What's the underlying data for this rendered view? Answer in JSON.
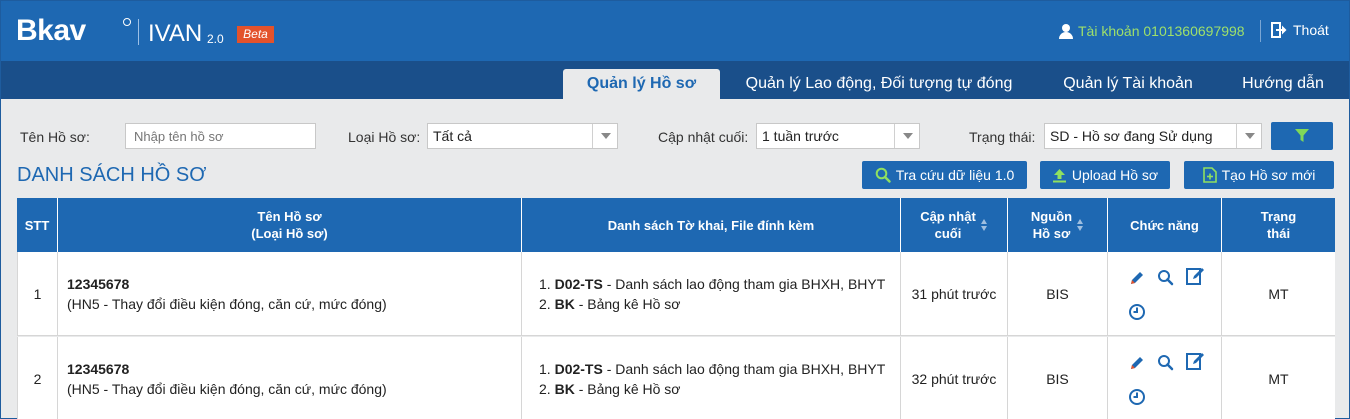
{
  "header": {
    "logo": "Bkav",
    "product": "IVAN",
    "product_version": "2.0",
    "beta": "Beta",
    "account_text": "Tài khoản 0101360697998",
    "logout": "Thoát",
    "colors": {
      "primary": "#1e68b2",
      "nav": "#1a4f8a",
      "account": "#9ee06a",
      "beta": "#e3522b"
    }
  },
  "nav": {
    "tabs": [
      {
        "label": "Quản lý Hồ sơ",
        "active": true
      },
      {
        "label": "Quản lý Lao động, Đối tượng tự đóng",
        "active": false
      },
      {
        "label": "Quản lý Tài khoản",
        "active": false
      },
      {
        "label": "Hướng dẫn",
        "active": false
      }
    ]
  },
  "filters": {
    "name_label": "Tên Hồ sơ:",
    "name_placeholder": "Nhập tên hồ sơ",
    "type_label": "Loại Hồ sơ:",
    "type_value": "Tất cả",
    "updated_label": "Cập nhật cuối:",
    "updated_value": "1 tuần trước",
    "status_label": "Trạng thái:",
    "status_value": "SD - Hồ sơ đang Sử dụng",
    "filter_icon": "funnel-icon"
  },
  "list": {
    "title": "DANH SÁCH HỒ SƠ",
    "buttons": {
      "lookup": "Tra cứu dữ liệu 1.0",
      "upload": "Upload Hồ sơ",
      "create": "Tạo Hồ sơ mới"
    }
  },
  "table": {
    "columns": {
      "stt": "STT",
      "name_line1": "Tên Hồ sơ",
      "name_line2": "(Loại Hồ sơ)",
      "docs": "Danh sách Tờ khai, File đính kèm",
      "updated_line1": "Cập nhật",
      "updated_line2": "cuối",
      "source_line1": "Nguồn",
      "source_line2": "Hồ sơ",
      "actions": "Chức năng",
      "status_line1": "Trạng",
      "status_line2": "thái"
    },
    "rows": [
      {
        "stt": "1",
        "name": "12345678",
        "type": "(HN5 - Thay đổi điều kiện đóng, căn cứ, mức đóng)",
        "docs": [
          {
            "num": "1.",
            "code": "D02-TS",
            "desc": " - Danh sách lao động tham gia BHXH, BHYT"
          },
          {
            "num": "2.",
            "code": "BK",
            "desc": " - Bảng kê Hồ sơ"
          }
        ],
        "updated": "31 phút trước",
        "source": "BIS",
        "status": "MT"
      },
      {
        "stt": "2",
        "name": "12345678",
        "type": "(HN5 - Thay đổi điều kiện đóng, căn cứ, mức đóng)",
        "docs": [
          {
            "num": "1.",
            "code": "D02-TS",
            "desc": " - Danh sách lao động tham gia BHXH, BHYT"
          },
          {
            "num": "2.",
            "code": "BK",
            "desc": " - Bảng kê Hồ sơ"
          }
        ],
        "updated": "32 phút trước",
        "source": "BIS",
        "status": "MT"
      }
    ]
  }
}
